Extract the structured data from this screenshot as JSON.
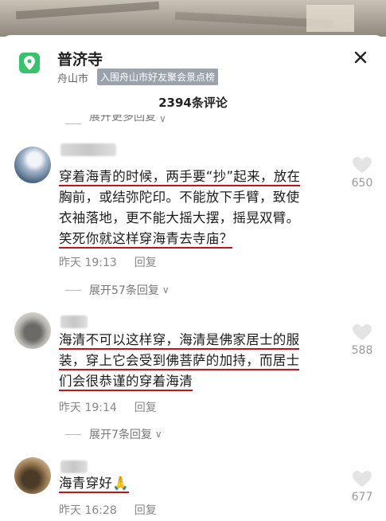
{
  "header": {
    "title": "普济寺",
    "city": "舟山市",
    "rank_badge": "入围舟山市好友聚会景点榜",
    "comment_count": "2394条评论"
  },
  "top_expand": {
    "label": "展开更多回复"
  },
  "comments": [
    {
      "lines": [
        "穿着海青的时候，两手要“抄”起来，放在",
        "胸前，或结弥陀印。不能放下手臂，致使",
        "衣袖落地，更不能大摇大摆，摇晃双臂。",
        "笑死你就这样穿海青去寺庙？"
      ],
      "time": "昨天 19:13",
      "reply_label": "回复",
      "likes": "650",
      "expand_label": "展开57条回复"
    },
    {
      "lines": [
        "海清不可以这样穿，海清是佛家居士的服",
        "装，穿上它会受到佛菩萨的加持，而居士",
        "们会很恭谨的穿着海清"
      ],
      "time": "昨天 19:14",
      "reply_label": "回复",
      "likes": "588",
      "expand_label": "展开7条回复"
    },
    {
      "lines": [
        "海青穿好🙏"
      ],
      "time": "昨天 16:28",
      "reply_label": "回复",
      "likes": "677"
    }
  ],
  "colors": {
    "underline": "#c0151b",
    "location_icon": "#35c46b"
  }
}
